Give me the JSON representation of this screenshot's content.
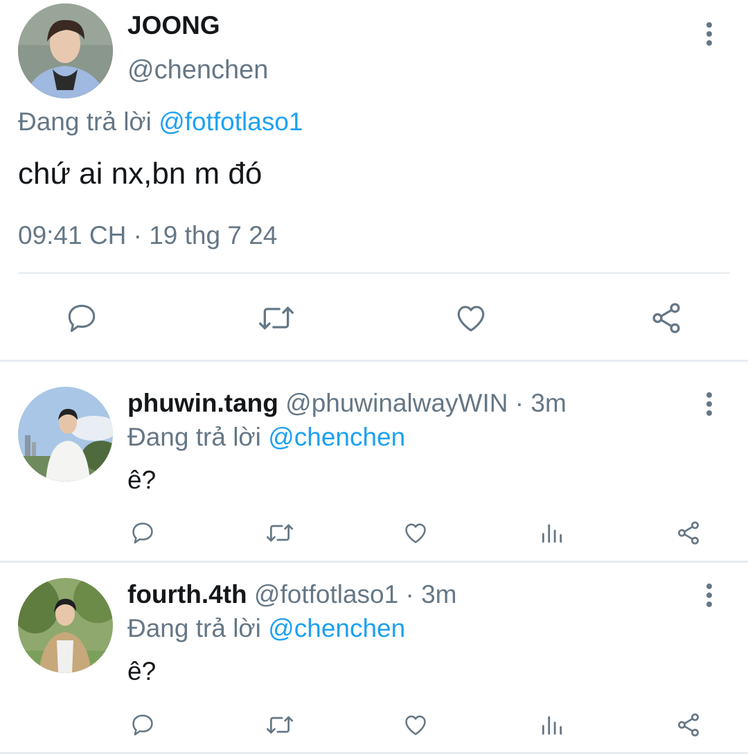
{
  "main_tweet": {
    "display_name": "JOONG",
    "handle": "@chenchen",
    "replying_prefix": "Đang trả lời",
    "replying_to": "@fotfotlaso1",
    "text": "chứ ai nx,bn m đó",
    "timestamp": "09:41 CH · 19 thg 7 24",
    "actions": [
      "reply-icon",
      "retweet-icon",
      "like-icon",
      "share-icon"
    ]
  },
  "replies": [
    {
      "display_name": "phuwin.tang",
      "handle": "@phuwinalwayWIN",
      "time": "· 3m",
      "replying_prefix": "Đang trả lời",
      "replying_to": "@chenchen",
      "text": "ê?"
    },
    {
      "display_name": "fourth.4th",
      "handle": "@fotfotlaso1",
      "time": "· 3m",
      "replying_prefix": "Đang trả lời",
      "replying_to": "@chenchen",
      "text": "ê?"
    }
  ],
  "colors": {
    "text": "#14171a",
    "secondary": "#657786",
    "link": "#1da1f2",
    "divider": "#e6ecf0"
  }
}
